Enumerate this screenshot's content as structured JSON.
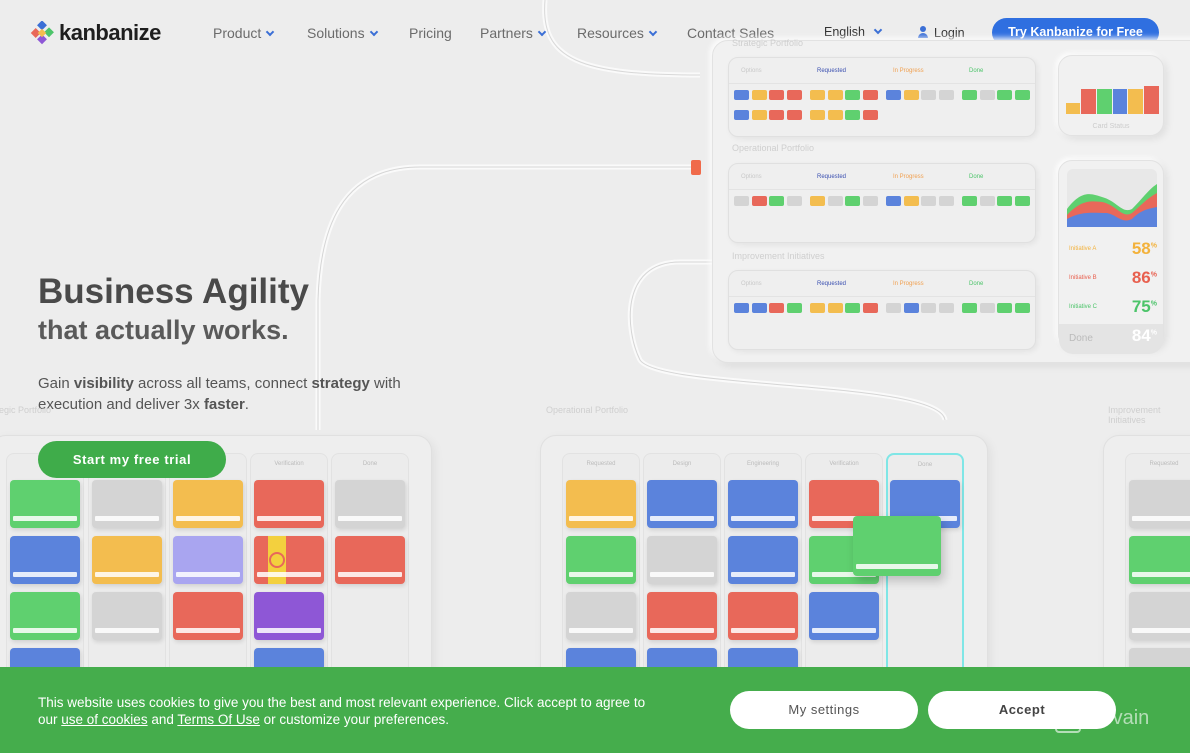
{
  "header": {
    "logo": "kanbanize",
    "nav": [
      {
        "label": "Product",
        "dropdown": true
      },
      {
        "label": "Solutions",
        "dropdown": true
      },
      {
        "label": "Pricing",
        "dropdown": false
      },
      {
        "label": "Partners",
        "dropdown": true
      },
      {
        "label": "Resources",
        "dropdown": true
      },
      {
        "label": "Contact Sales",
        "dropdown": false
      }
    ],
    "language": "English",
    "login": "Login",
    "cta": "Try Kanbanize for Free"
  },
  "hero": {
    "title": "Business Agility",
    "subtitle": "that actually works.",
    "desc": {
      "p1": "Gain ",
      "b1": "visibility",
      "p2": " across all teams, connect ",
      "b2": "strategy",
      "p3": " with execution and deliver 3x ",
      "b3": "faster",
      "p4": "."
    },
    "button": "Start my free trial"
  },
  "illustration": {
    "portfolios": [
      "Strategic Portfolio",
      "Operational Portfolio",
      "Improvement Initiatives"
    ],
    "columns": [
      "Options",
      "Requested",
      "In Progress",
      "Done"
    ],
    "column_colors": [
      "#c9c9c9",
      "#3a4fb0",
      "#f0a050",
      "#4cc46a"
    ],
    "rows": [
      [
        [
          "b",
          "y",
          "r",
          "r",
          "y",
          "y",
          "g",
          "r",
          "b",
          "y",
          "x",
          "x",
          "g",
          "x",
          "g",
          "g"
        ],
        [
          "b",
          "y",
          "r",
          "r",
          "y",
          "y",
          "g",
          "r"
        ]
      ],
      [
        [
          "x",
          "r",
          "g",
          "x",
          "y",
          "x",
          "g",
          "x",
          "b",
          "y",
          "x",
          "x",
          "g",
          "x",
          "g",
          "g"
        ]
      ],
      [
        [
          "b",
          "b",
          "r",
          "g",
          "y",
          "y",
          "g",
          "r",
          "x",
          "b",
          "x",
          "x",
          "g",
          "x",
          "g",
          "g"
        ]
      ]
    ],
    "card_status_label": "Card Status",
    "bars": [
      {
        "c": "y",
        "v": 0.4
      },
      {
        "c": "r",
        "v": 0.9
      },
      {
        "c": "g",
        "v": 0.9
      },
      {
        "c": "b",
        "v": 0.9
      },
      {
        "c": "y",
        "v": 0.9
      },
      {
        "c": "r",
        "v": 1
      }
    ],
    "initiatives": [
      {
        "name": "Initiative A",
        "value": "58",
        "color": "#f3b23c"
      },
      {
        "name": "Initiative B",
        "value": "86",
        "color": "#e8604f"
      },
      {
        "name": "Initiative C",
        "value": "75",
        "color": "#4cc46a"
      },
      {
        "name": "Done",
        "value": "84",
        "color": "#ffffff"
      }
    ],
    "percent": "%",
    "boards": [
      {
        "title": "Strategic Portfolio",
        "labels": [
          "",
          "",
          "",
          "Verification",
          "Done"
        ],
        "cols": [
          [
            "g",
            "b",
            "g",
            "b"
          ],
          [
            "x",
            "y",
            "x"
          ],
          [
            "y",
            "p",
            "r"
          ],
          [
            "r",
            "ry",
            "v",
            "b"
          ],
          [
            "x",
            "r"
          ]
        ]
      },
      {
        "title": "Operational Portfolio",
        "labels": [
          "Requested",
          "Design",
          "Engineering",
          "Verification",
          "Done"
        ],
        "cols": [
          [
            "y",
            "g",
            "x",
            "b"
          ],
          [
            "b",
            "x",
            "r",
            "b"
          ],
          [
            "b",
            "b",
            "r",
            "b"
          ],
          [
            "r",
            "g",
            "b"
          ],
          [
            "b"
          ]
        ]
      },
      {
        "title": "Improvement Initiatives",
        "labels": [
          "Requested"
        ],
        "cols": [
          [
            "x",
            "g",
            "x",
            "x"
          ]
        ]
      }
    ],
    "colors": {
      "b": "#5b83dc",
      "y": "#f3bd4f",
      "r": "#e8685a",
      "g": "#5fd06f",
      "x": "#d4d4d4",
      "p": "#a9a5f0",
      "v": "#8e57d6",
      "ry": "#e8685a"
    }
  },
  "cookie": {
    "line1": "This website uses cookies to give you the best and most relevant experience. Click accept to agree to",
    "our": "our ",
    "link1": "use of cookies",
    "and": " and ",
    "link2": "Terms Of Use",
    "rest": " or customize your preferences.",
    "settings": "My settings",
    "accept": "Accept"
  },
  "watermark": "Revain",
  "colors": {
    "primary": "#2f6fe0",
    "green": "#45ad4c"
  }
}
